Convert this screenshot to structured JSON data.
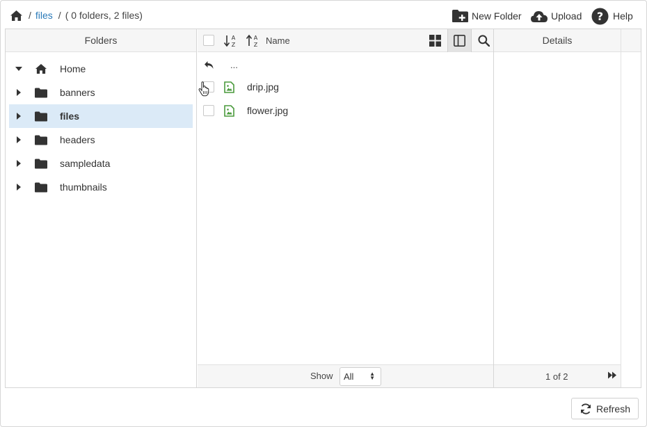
{
  "breadcrumb": {
    "home_icon": "home-icon",
    "separator": "/",
    "current": "files",
    "summary": "( 0 folders, 2 files)"
  },
  "toolbar": {
    "new_folder_label": "New Folder",
    "upload_label": "Upload",
    "help_label": "Help"
  },
  "folders": {
    "header": "Folders",
    "items": [
      {
        "label": "Home",
        "icon": "home-icon",
        "expanded": true,
        "selected": false
      },
      {
        "label": "banners",
        "icon": "folder-icon",
        "expanded": false,
        "selected": false
      },
      {
        "label": "files",
        "icon": "folder-icon",
        "expanded": false,
        "selected": true
      },
      {
        "label": "headers",
        "icon": "folder-icon",
        "expanded": false,
        "selected": false
      },
      {
        "label": "sampledata",
        "icon": "folder-icon",
        "expanded": false,
        "selected": false
      },
      {
        "label": "thumbnails",
        "icon": "folder-icon",
        "expanded": false,
        "selected": false
      }
    ]
  },
  "files": {
    "column_name": "Name",
    "up_label": "...",
    "rows": [
      {
        "name": "drip.jpg",
        "icon": "image-file-icon"
      },
      {
        "name": "flower.jpg",
        "icon": "image-file-icon"
      }
    ],
    "show_label": "Show",
    "show_value": "All"
  },
  "details": {
    "header": "Details",
    "pager": "1 of 2"
  },
  "footer": {
    "refresh_label": "Refresh"
  },
  "colors": {
    "link": "#2a7ab8",
    "selected_bg": "#dbeaf7",
    "image_icon": "#4a9a3c"
  }
}
